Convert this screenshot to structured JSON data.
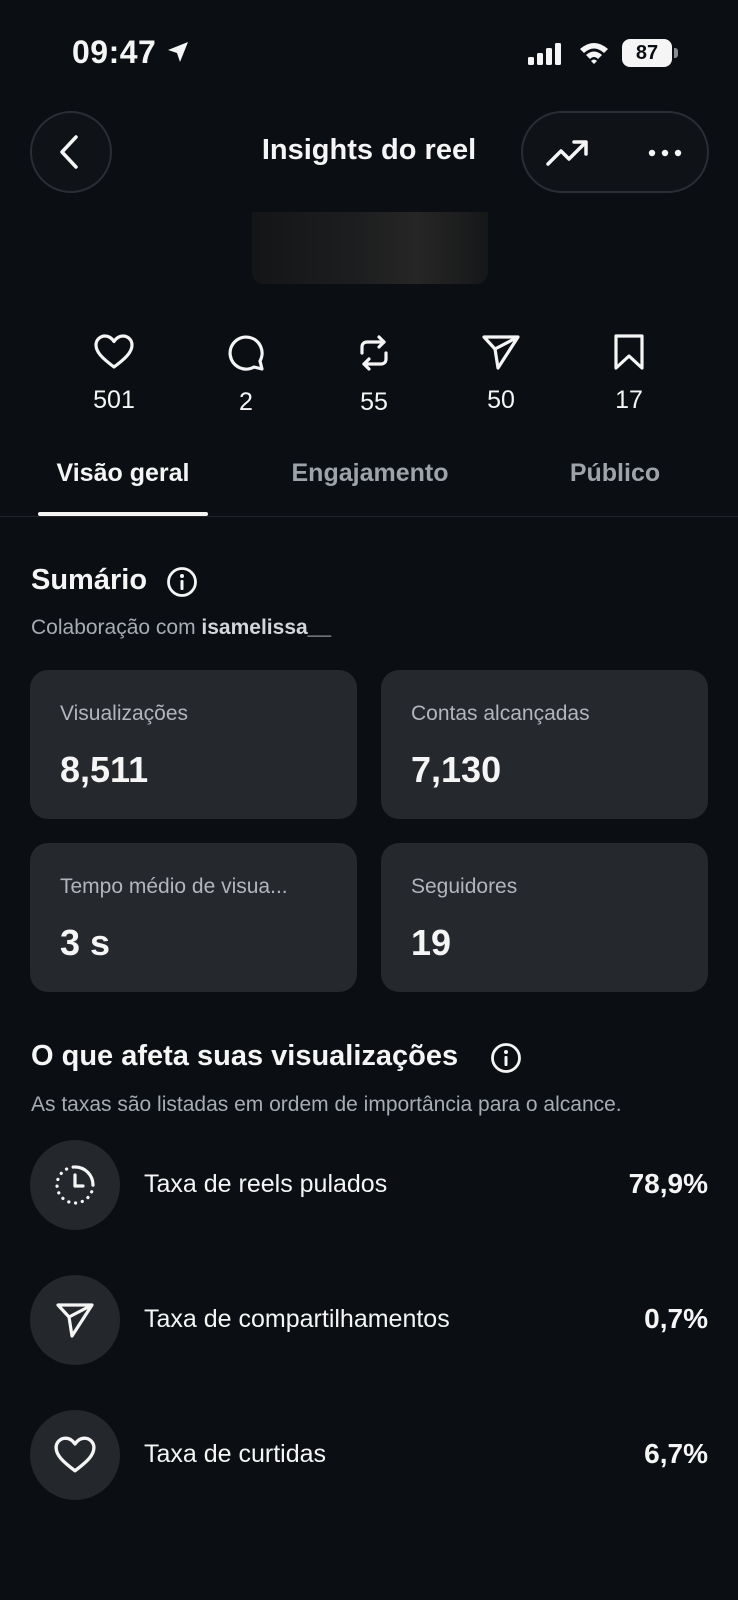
{
  "status_bar": {
    "time": "09:47",
    "battery": "87"
  },
  "header": {
    "title": "Insights do reel"
  },
  "metrics": [
    {
      "name": "likes",
      "icon": "heart-icon",
      "count": "501"
    },
    {
      "name": "comments",
      "icon": "comment-icon",
      "count": "2"
    },
    {
      "name": "reposts",
      "icon": "repost-icon",
      "count": "55"
    },
    {
      "name": "shares",
      "icon": "send-icon",
      "count": "50"
    },
    {
      "name": "saves",
      "icon": "bookmark-icon",
      "count": "17"
    }
  ],
  "tabs": [
    {
      "label": "Visão geral",
      "active": true
    },
    {
      "label": "Engajamento",
      "active": false
    },
    {
      "label": "Público",
      "active": false
    }
  ],
  "summary": {
    "title": "Sumário",
    "collab_prefix": "Colaboração com ",
    "collab_user": "isamelissa__",
    "cards": [
      {
        "label": "Visualizações",
        "value": "8,511"
      },
      {
        "label": "Contas alcançadas",
        "value": "7,130"
      },
      {
        "label": "Tempo médio de visua...",
        "value": "3 s"
      },
      {
        "label": "Seguidores",
        "value": "19"
      }
    ]
  },
  "views_factors": {
    "title": "O que afeta suas visualizações",
    "subtitle": "As taxas são listadas em ordem de importância para o alcance.",
    "rates": [
      {
        "icon": "skip-timer-icon",
        "label": "Taxa de reels pulados",
        "value": "78,9%"
      },
      {
        "icon": "send-icon",
        "label": "Taxa de compartilhamentos",
        "value": "0,7%"
      },
      {
        "icon": "heart-icon",
        "label": "Taxa de curtidas",
        "value": "6,7%"
      }
    ]
  },
  "colors": {
    "background": "#0b0f14",
    "card": "#25282d",
    "text": "#f5f5f5",
    "muted": "#a7abb2"
  }
}
